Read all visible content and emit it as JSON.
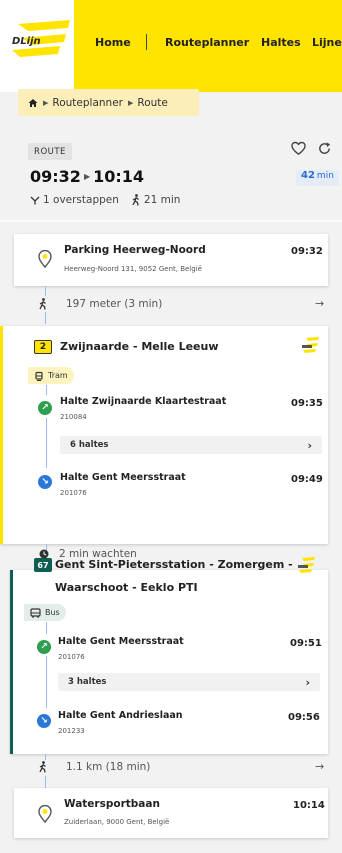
{
  "nav": {
    "logo_text": "DLijn",
    "items": [
      "Home",
      "Routeplanner",
      "Haltes",
      "Lijnen"
    ]
  },
  "breadcrumb": {
    "items": [
      "Routeplanner",
      "Route"
    ]
  },
  "summary": {
    "tag": "ROUTE",
    "departure": "09:32",
    "arrival": "10:14",
    "duration_value": "42",
    "duration_unit": "min",
    "transfers": "1 overstappen",
    "walk_time": "21 min"
  },
  "start": {
    "name": "Parking Heerweg-Noord",
    "address": "Heerweg-Noord 131, 9052 Gent, België",
    "time": "09:32"
  },
  "walk1": {
    "text": "197 meter (3 min)"
  },
  "leg1": {
    "line_number": "2",
    "line_name": "Zwijnaarde - Melle Leeuw",
    "mode": "Tram",
    "board_stop": "Halte Zwijnaarde Klaartestraat",
    "board_code": "210084",
    "board_time": "09:35",
    "stops_count": "6 haltes",
    "alight_stop": "Halte Gent Meersstraat",
    "alight_code": "201076",
    "alight_time": "09:49",
    "color": "#ffe400"
  },
  "wait": {
    "text": "2 min wachten"
  },
  "leg2": {
    "line_number": "67",
    "line_name_1": "Gent Sint-Pietersstation - Zomergem -",
    "line_name_2": "Waarschoot - Eeklo PTI",
    "mode": "Bus",
    "board_stop": "Halte Gent Meersstraat",
    "board_code": "201076",
    "board_time": "09:51",
    "stops_count": "3 haltes",
    "alight_stop": "Halte Gent Andrieslaan",
    "alight_code": "201233",
    "alight_time": "09:56",
    "color": "#0f5e52"
  },
  "walk2": {
    "text": "1.1 km (18 min)"
  },
  "end": {
    "name": "Watersportbaan",
    "address": "Zuiderlaan, 9000 Gent, België",
    "time": "10:14"
  }
}
